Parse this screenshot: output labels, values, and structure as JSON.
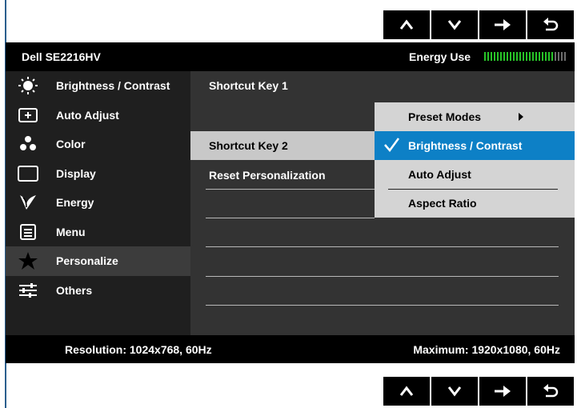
{
  "header": {
    "model": "Dell SE2216HV",
    "energy_label": "Energy Use",
    "energy_level": 0.85
  },
  "nav_buttons": [
    "up-arrow",
    "down-arrow",
    "right-arrow",
    "back-arrow"
  ],
  "menu": {
    "items": [
      {
        "label": "Brightness / Contrast",
        "icon": "sun-icon"
      },
      {
        "label": "Auto Adjust",
        "icon": "auto-adjust-icon"
      },
      {
        "label": "Color",
        "icon": "color-dots-icon"
      },
      {
        "label": "Display",
        "icon": "display-icon"
      },
      {
        "label": "Energy",
        "icon": "energy-leaf-icon"
      },
      {
        "label": "Menu",
        "icon": "menu-icon"
      },
      {
        "label": "Personalize",
        "icon": "star-icon"
      },
      {
        "label": "Others",
        "icon": "sliders-icon"
      }
    ],
    "selected": "Personalize"
  },
  "personalize": {
    "items": [
      "Shortcut Key 1",
      "Shortcut Key 2",
      "Reset Personalization"
    ],
    "selected": "Shortcut Key 2"
  },
  "submenu": {
    "items": [
      "Preset Modes",
      "Brightness / Contrast",
      "Auto Adjust",
      "Aspect Ratio"
    ],
    "active": "Brightness / Contrast"
  },
  "footer": {
    "resolution": "Resolution: 1024x768, 60Hz",
    "maximum": "Maximum: 1920x1080, 60Hz"
  },
  "colors": {
    "accent": "#0d80c6",
    "energy_bar": "#28c328"
  }
}
